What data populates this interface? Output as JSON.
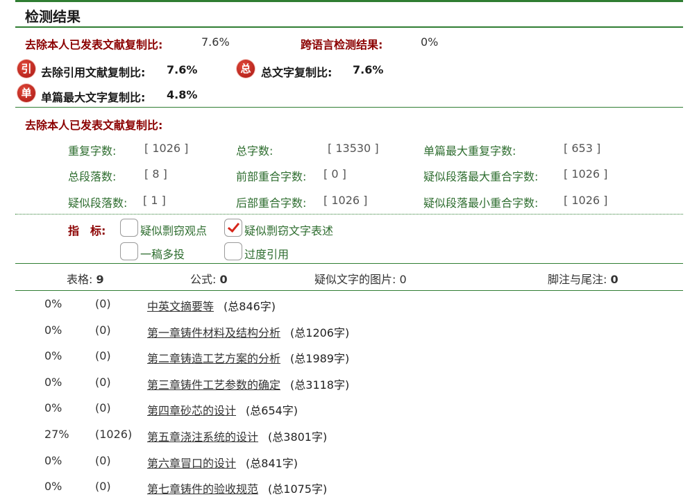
{
  "header": {
    "title": "检测结果"
  },
  "top_stats": {
    "excl_self_label": "去除本人已发表文献复制比:",
    "excl_self_value": "7.6%",
    "cross_lang_label": "跨语言检测结果:",
    "cross_lang_value": "0%"
  },
  "badges": {
    "yin": {
      "icon": "引",
      "label": "去除引用文献复制比:",
      "value": "7.6%"
    },
    "zong": {
      "icon": "总",
      "label": "总文字复制比:",
      "value": "7.6%"
    },
    "dan": {
      "icon": "单",
      "label": "单篇最大文字复制比:",
      "value": "4.8%"
    }
  },
  "section_title": "去除本人已发表文献复制比:",
  "stats": [
    {
      "label": "重复字数:",
      "value": "[ 1026 ]"
    },
    {
      "label": "总字数:",
      "value": "[ 13530 ]"
    },
    {
      "label": "单篇最大重复字数:",
      "value": "[ 653 ]"
    },
    {
      "label": "总段落数:",
      "value": "[ 8 ]"
    },
    {
      "label": "前部重合字数:",
      "value": "[ 0 ]"
    },
    {
      "label": "疑似段落最大重合字数:",
      "value": "[ 1026 ]"
    },
    {
      "label": "疑似段落数:",
      "value": "[ 1 ]"
    },
    {
      "label": "后部重合字数:",
      "value": "[ 1026 ]"
    },
    {
      "label": "疑似段落最小重合字数:",
      "value": "[ 1026 ]"
    }
  ],
  "indicators": {
    "label": "指　标:",
    "items": [
      {
        "label": "疑似剽窃观点",
        "checked": false
      },
      {
        "label": "疑似剽窃文字表述",
        "checked": true
      },
      {
        "label": "一稿多投",
        "checked": false
      },
      {
        "label": "过度引用",
        "checked": false
      }
    ]
  },
  "summary": {
    "tables_label": "表格:",
    "tables_value": "9",
    "formula_label": "公式:",
    "formula_value": "0",
    "images_label": "疑似文字的图片:",
    "images_value": "0",
    "footnote_label": "脚注与尾注:",
    "footnote_value": "0"
  },
  "chapters": [
    {
      "pct": "0%",
      "count": "(0)",
      "title": "中英文摘要等",
      "total": "(总846字)"
    },
    {
      "pct": "0%",
      "count": "(0)",
      "title": "第一章铸件材料及结构分析",
      "total": "(总1206字)"
    },
    {
      "pct": "0%",
      "count": "(0)",
      "title": "第二章铸造工艺方案的分析",
      "total": "(总1989字)"
    },
    {
      "pct": "0%",
      "count": "(0)",
      "title": "第三章铸件工艺参数的确定",
      "total": "(总3118字)"
    },
    {
      "pct": "0%",
      "count": "(0)",
      "title": "第四章砂芯的设计",
      "total": "(总654字)"
    },
    {
      "pct": "27%",
      "count": "(1026)",
      "title": "第五章浇注系统的设计",
      "total": "(总3801字)"
    },
    {
      "pct": "0%",
      "count": "(0)",
      "title": "第六章冒口的设计",
      "total": "(总841字)"
    },
    {
      "pct": "0%",
      "count": "(0)",
      "title": "第七章铸件的验收规范",
      "total": "(总1075字)"
    }
  ]
}
